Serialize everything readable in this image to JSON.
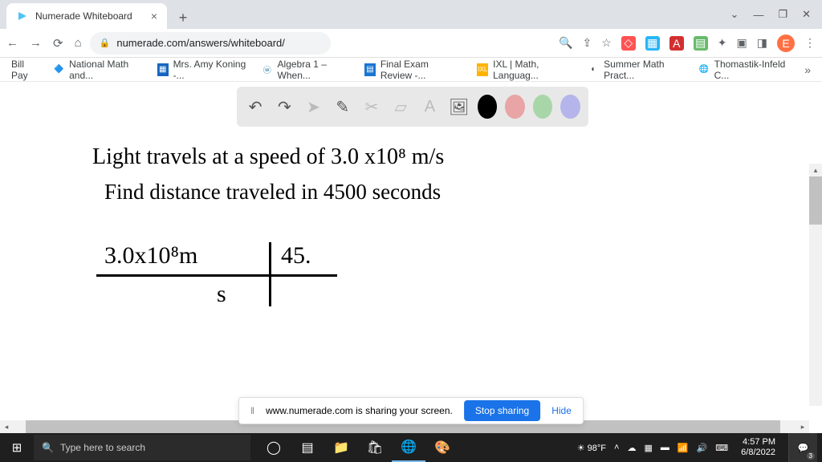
{
  "tab": {
    "title": "Numerade Whiteboard"
  },
  "address": {
    "url": "numerade.com/answers/whiteboard/"
  },
  "bookmarks": [
    {
      "label": "Bill Pay"
    },
    {
      "label": "National Math and..."
    },
    {
      "label": "Mrs. Amy Koning -..."
    },
    {
      "label": "Algebra 1 – When..."
    },
    {
      "label": "Final Exam Review -..."
    },
    {
      "label": "IXL | Math, Languag..."
    },
    {
      "label": "Summer Math Pract..."
    },
    {
      "label": "Thomastik-Infeld C..."
    }
  ],
  "toolbar": {
    "colors": {
      "black": "#000000",
      "pink": "#e9a5a5",
      "green": "#a9d6a9",
      "purple": "#b5b5ec"
    }
  },
  "handwriting": {
    "line1": "Light travels at a speed of  3.0 x10⁸ m/s",
    "line2": "Find distance traveled in 4500 seconds",
    "frac_top_left": "3.0x10⁸m",
    "frac_top_right": "45.",
    "frac_bottom": "s"
  },
  "share": {
    "msg": "www.numerade.com is sharing your screen.",
    "stop": "Stop sharing",
    "hide": "Hide"
  },
  "taskbar": {
    "search_placeholder": "Type here to search",
    "weather": "98°F",
    "time": "4:57 PM",
    "date": "6/8/2022",
    "notif_count": "3"
  },
  "avatar": {
    "initial": "E"
  }
}
